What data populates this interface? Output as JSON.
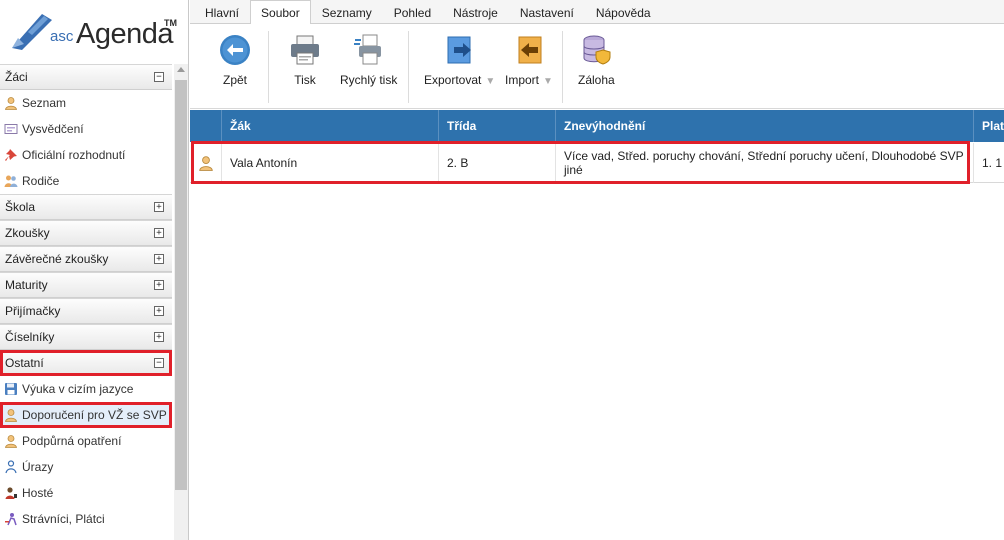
{
  "app": {
    "logo_prefix": "asc",
    "logo_name": "Agenda",
    "logo_tm": "TM"
  },
  "menu": {
    "tabs": [
      {
        "label": "Hlavní"
      },
      {
        "label": "Soubor"
      },
      {
        "label": "Seznamy"
      },
      {
        "label": "Pohled"
      },
      {
        "label": "Nástroje"
      },
      {
        "label": "Nastavení"
      },
      {
        "label": "Nápověda"
      }
    ],
    "active": "Soubor"
  },
  "toolbar": {
    "back": "Zpět",
    "print": "Tisk",
    "quick_print": "Rychlý tisk",
    "export": "Exportovat",
    "import": "Import",
    "backup": "Záloha",
    "dropdown_glyph": "▼"
  },
  "sidebar": {
    "collapse_glyph": "−",
    "expand_glyph": "+",
    "zaci": {
      "title": "Žáci",
      "items": [
        {
          "label": "Seznam",
          "icon": "person-icon"
        },
        {
          "label": "Vysvědčení",
          "icon": "certificate-icon"
        },
        {
          "label": "Oficiální rozhodnutí",
          "icon": "pin-icon"
        },
        {
          "label": "Rodiče",
          "icon": "parents-icon"
        }
      ]
    },
    "collapsed": [
      "Škola",
      "Zkoušky",
      "Závěrečné zkoušky",
      "Maturity",
      "Přijímačky",
      "Číselníky"
    ],
    "ostatni": {
      "title": "Ostatní",
      "items": [
        {
          "label": "Výuka v cizím jazyce",
          "icon": "floppy-icon"
        },
        {
          "label": "Doporučení pro VŽ se SVP",
          "icon": "person-icon"
        },
        {
          "label": "Podpůrná opatření",
          "icon": "person-icon"
        },
        {
          "label": "Úrazy",
          "icon": "injury-icon"
        },
        {
          "label": "Hosté",
          "icon": "guest-icon"
        },
        {
          "label": "Strávníci, Plátci",
          "icon": "diner-icon"
        }
      ]
    }
  },
  "grid": {
    "columns": [
      "Žák",
      "Třída",
      "Znevýhodnění",
      "Plat"
    ],
    "rows": [
      {
        "student": "Vala Antonín",
        "class": "2. B",
        "disadvantage": "Více vad, Střed. poruchy chování, Střední poruchy učení, Dlouhodobé SVP jiné",
        "plat": "1. 1"
      }
    ]
  },
  "colors": {
    "header_blue": "#2e72ad",
    "highlight_red": "#e0202a",
    "toolbar_blue": "#3b82c4"
  }
}
